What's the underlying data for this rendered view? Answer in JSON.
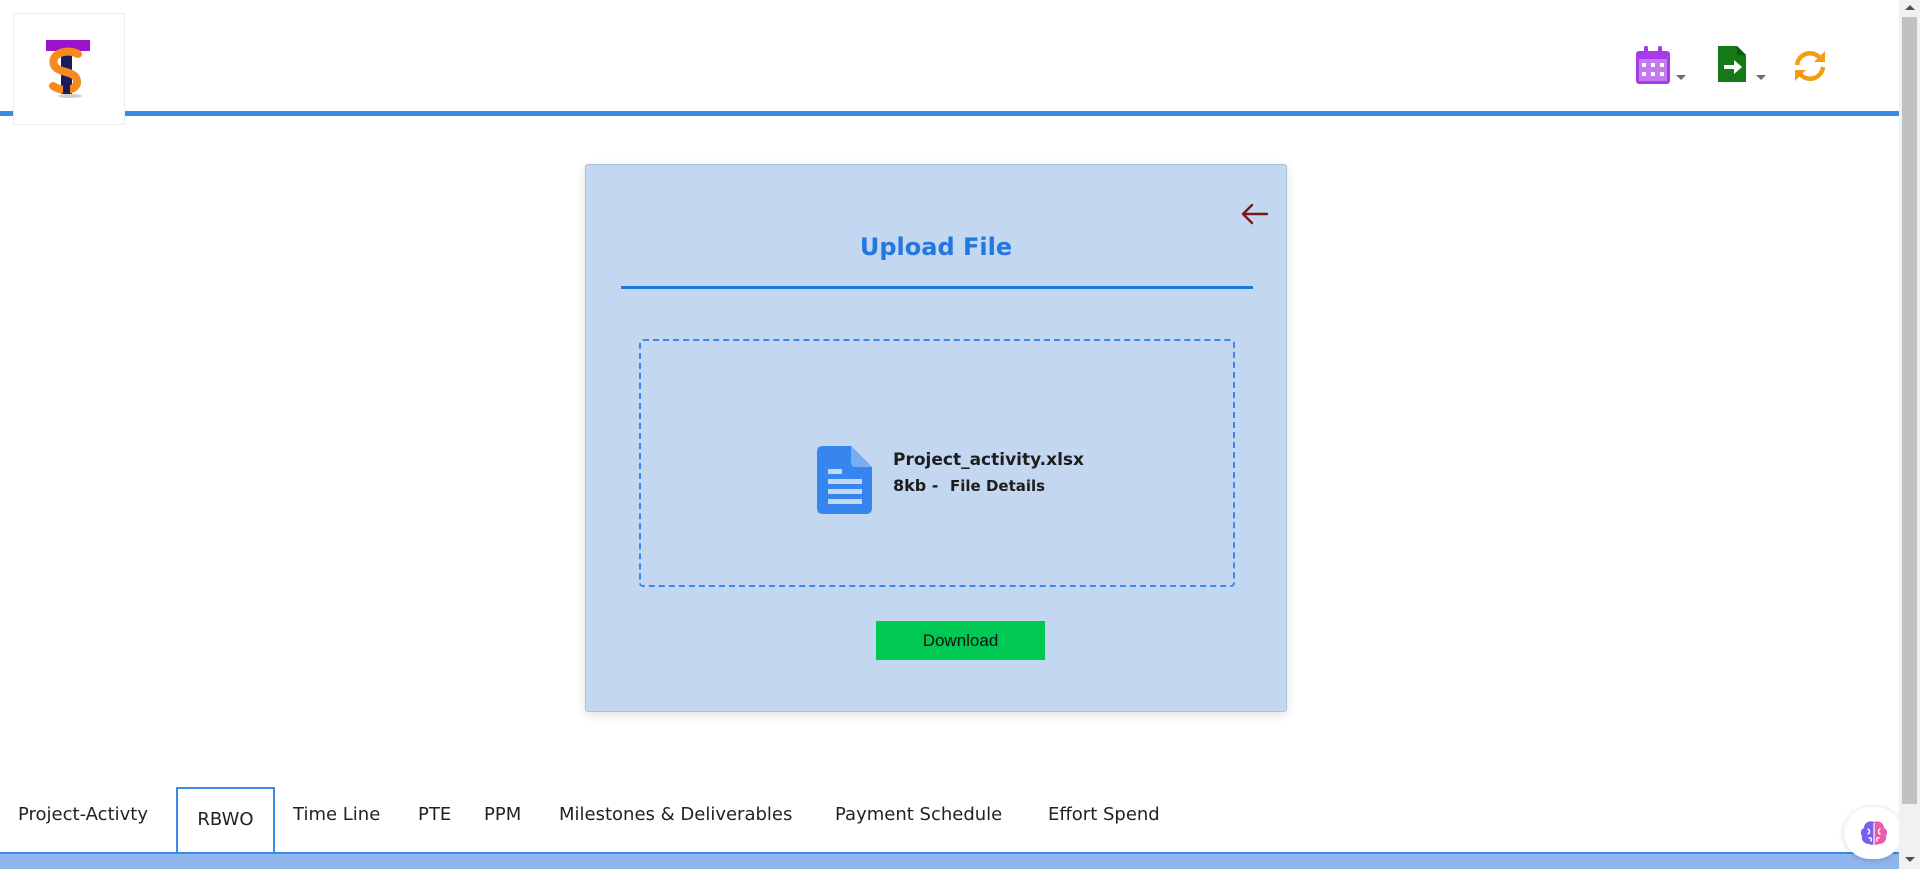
{
  "header": {
    "logo_icon": "ts-logo",
    "actions": [
      {
        "icon": "calendar-icon",
        "color": "#a63ce8",
        "has_dropdown": true
      },
      {
        "icon": "file-export-icon",
        "color": "#157a15",
        "has_dropdown": true
      },
      {
        "icon": "refresh-icon",
        "color": "#f39c12",
        "has_dropdown": false
      }
    ],
    "accent_color": "#3b8ae8"
  },
  "upload": {
    "title": "Upload File",
    "back_icon": "arrow-left-icon",
    "file": {
      "icon": "document-icon",
      "name": "Project_activity.xlsx",
      "size": "8kb -",
      "details_link": "File Details"
    },
    "download_label": "Download",
    "card_color": "#c3d7f1",
    "download_color": "#00c853"
  },
  "tabs": [
    {
      "label": "Project-Activty",
      "active": false
    },
    {
      "label": "RBWO",
      "active": true
    },
    {
      "label": "Time Line",
      "active": false
    },
    {
      "label": "PTE",
      "active": false
    },
    {
      "label": "PPM",
      "active": false
    },
    {
      "label": "Milestones & Deliverables",
      "active": false
    },
    {
      "label": "Payment Schedule",
      "active": false
    },
    {
      "label": "Effort Spend",
      "active": false
    }
  ],
  "assistant": {
    "icon": "brain-icon"
  }
}
